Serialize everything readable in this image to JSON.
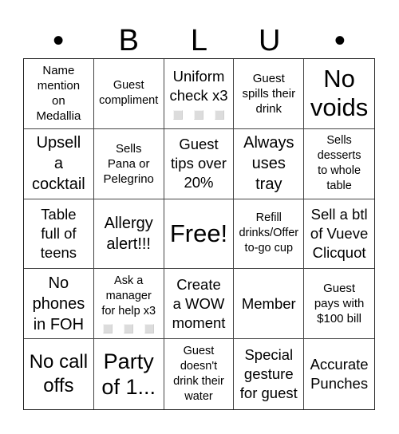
{
  "header": {
    "letters": [
      "•",
      "B",
      "L",
      "U",
      "•"
    ]
  },
  "cells": [
    {
      "text": "Name\nmention\non\nMedallia"
    },
    {
      "text": "Guest\ncompliment"
    },
    {
      "text": "Uniform\ncheck x3",
      "checkboxes": 3
    },
    {
      "text": "Guest\nspills their\ndrink"
    },
    {
      "text": "No\nvoids"
    },
    {
      "text": "Upsell\na\ncocktail"
    },
    {
      "text": "Sells\nPana or\nPelegrino"
    },
    {
      "text": "Guest\ntips over\n20%"
    },
    {
      "text": "Always\nuses\ntray"
    },
    {
      "text": "Sells\ndesserts\nto whole\ntable"
    },
    {
      "text": "Table\nfull of\nteens"
    },
    {
      "text": "Allergy\nalert!!!"
    },
    {
      "text": "Free!"
    },
    {
      "text": "Refill\ndrinks/Offer\nto-go cup"
    },
    {
      "text": "Sell a btl\nof Vueve\nClicquot"
    },
    {
      "text": "No\nphones\nin FOH"
    },
    {
      "text": "Ask a\nmanager\nfor help x3",
      "checkboxes": 3
    },
    {
      "text": "Create\na WOW\nmoment"
    },
    {
      "text": "Member"
    },
    {
      "text": "Guest\npays with\n$100 bill"
    },
    {
      "text": "No call\noffs"
    },
    {
      "text": "Party\nof 1..."
    },
    {
      "text": "Guest\ndoesn't\ndrink their\nwater"
    },
    {
      "text": "Special\ngesture\nfor guest"
    },
    {
      "text": "Accurate\nPunches"
    }
  ]
}
